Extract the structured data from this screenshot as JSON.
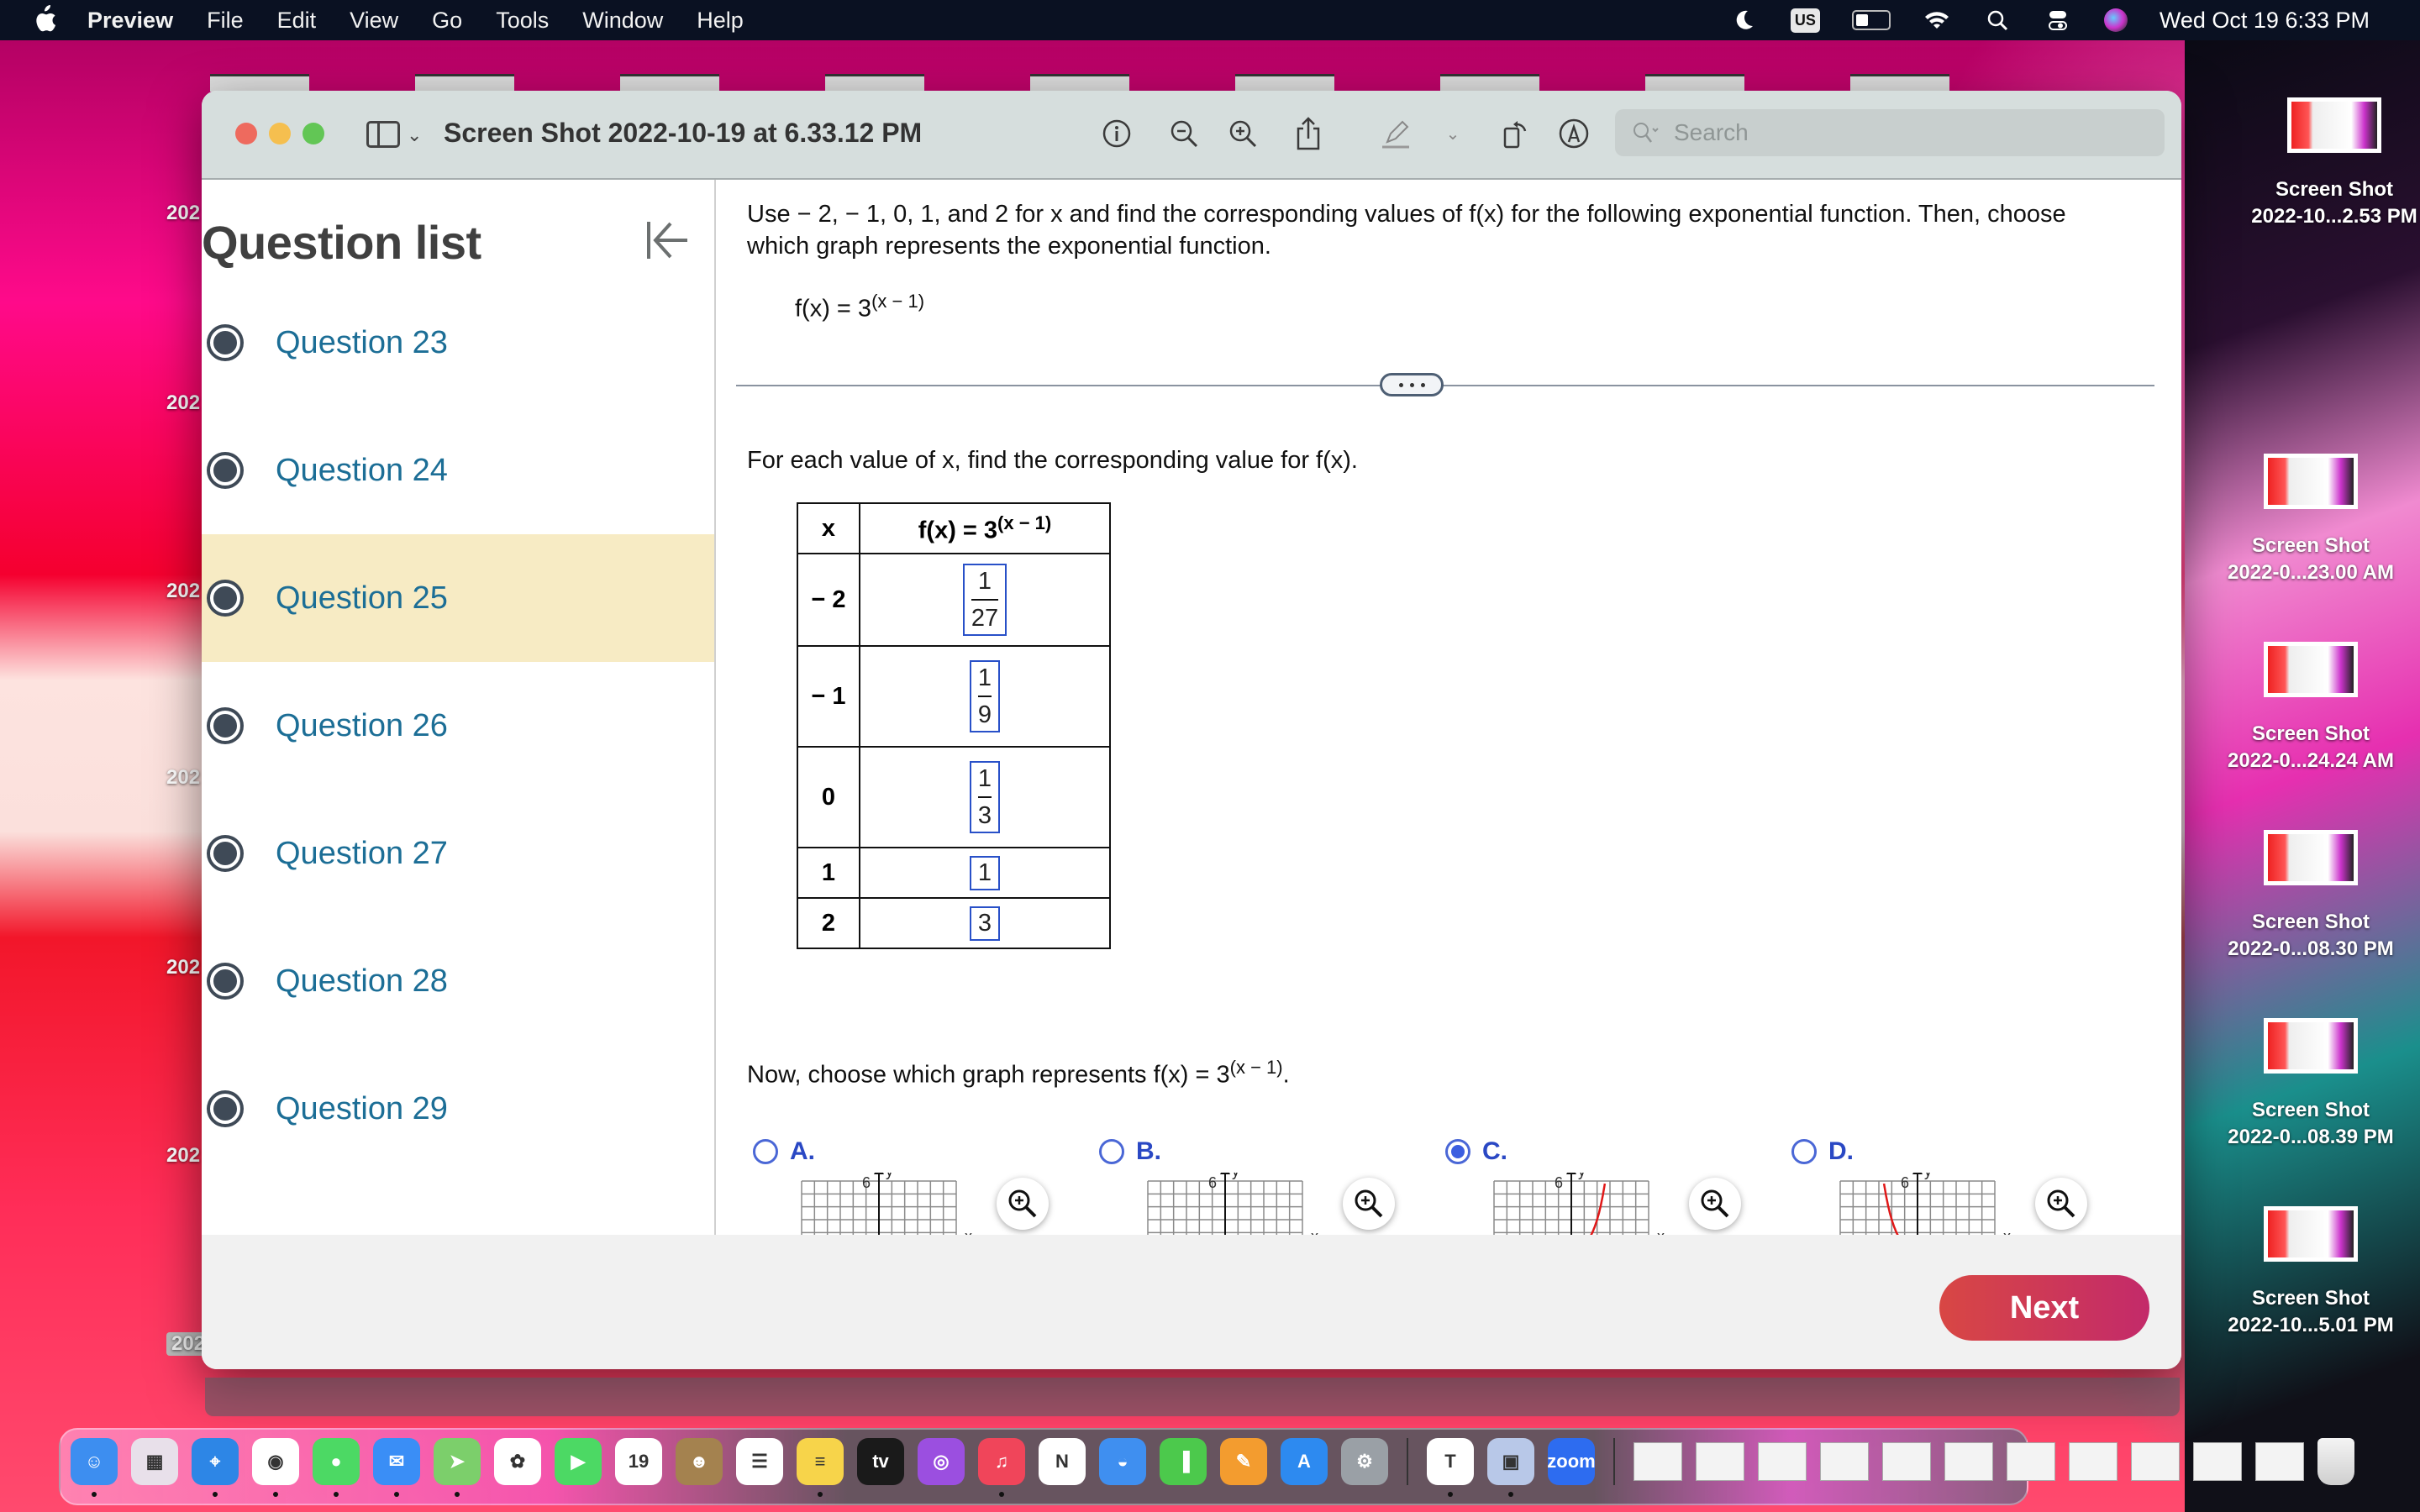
{
  "menubar": {
    "apple": "",
    "app_name": "Preview",
    "items": [
      "File",
      "Edit",
      "View",
      "Go",
      "Tools",
      "Window",
      "Help"
    ],
    "input_source": "US",
    "clock": "Wed Oct 19  6:33 PM"
  },
  "window": {
    "title": "Screen Shot 2022-10-19 at 6.33.12 PM",
    "search_placeholder": "Search",
    "search_value": ""
  },
  "question_list": {
    "title": "Question list",
    "items": [
      {
        "label": "Question 23",
        "current": false
      },
      {
        "label": "Question 24",
        "current": false
      },
      {
        "label": "Question 25",
        "current": true
      },
      {
        "label": "Question 26",
        "current": false
      },
      {
        "label": "Question 27",
        "current": false
      },
      {
        "label": "Question 28",
        "current": false
      },
      {
        "label": "Question 29",
        "current": false
      }
    ]
  },
  "question": {
    "instructions": "Use  − 2, − 1, 0, 1, and 2 for x and find the corresponding values of f(x) for the following exponential function.  Then, choose which graph represents the exponential function.",
    "function_base": "f(x) = 3",
    "function_exponent": "(x − 1)",
    "subprompt": "For each value of x, find the corresponding value for f(x).",
    "table": {
      "header_x": "x",
      "header_f_base": "f(x) = 3",
      "header_f_exp": "(x − 1)",
      "rows": [
        {
          "x": "− 2",
          "numerator": "1",
          "denominator": "27"
        },
        {
          "x": "− 1",
          "numerator": "1",
          "denominator": "9"
        },
        {
          "x": "0",
          "numerator": "1",
          "denominator": "3"
        },
        {
          "x": "1",
          "value": "1"
        },
        {
          "x": "2",
          "value": "3"
        }
      ]
    },
    "choose_prompt_pre": "Now, choose which graph represents f(x) = 3",
    "choose_prompt_exp": "(x − 1)",
    "choose_prompt_post": ".",
    "options": [
      {
        "label": "A.",
        "selected": false,
        "curve": "increasing-shifted-right",
        "y_tick": "6",
        "x_axis": "x",
        "y_axis": "y"
      },
      {
        "label": "B.",
        "selected": false,
        "curve": "decreasing-shifted-left",
        "y_tick": "6",
        "x_axis": "x",
        "y_axis": "y"
      },
      {
        "label": "C.",
        "selected": true,
        "curve": "increasing",
        "y_tick": "6",
        "x_axis": "x",
        "y_axis": "y"
      },
      {
        "label": "D.",
        "selected": false,
        "curve": "decreasing",
        "y_tick": "6",
        "x_axis": "x",
        "y_axis": "y"
      }
    ],
    "next_label": "Next"
  },
  "desktop_files": [
    {
      "line1": "Screen Shot",
      "line2": "2022-10...2.53 PM"
    },
    {
      "line1": "Screen Shot",
      "line2": "2022-0...23.00 AM"
    },
    {
      "line1": "Screen Shot",
      "line2": "2022-0...24.24 AM"
    },
    {
      "line1": "Screen Shot",
      "line2": "2022-0...08.30 PM"
    },
    {
      "line1": "Screen Shot",
      "line2": "2022-0...08.39 PM"
    },
    {
      "line1": "Screen Shot",
      "line2": "2022-10...5.01 PM"
    }
  ],
  "left_desktop_labels": [
    "202",
    "202",
    "202",
    "202",
    "202",
    "202",
    "202"
  ],
  "dock": {
    "apps": [
      {
        "name": "Finder",
        "color": "#3d8ef0",
        "glyph": "☺",
        "running": true
      },
      {
        "name": "Launchpad",
        "color": "#e8e0ea",
        "glyph": "▦",
        "running": false
      },
      {
        "name": "Safari",
        "color": "#2d86e6",
        "glyph": "⌖",
        "running": true
      },
      {
        "name": "Chrome",
        "color": "#ffffff",
        "glyph": "◉",
        "running": true
      },
      {
        "name": "Messages",
        "color": "#4cd964",
        "glyph": "●",
        "running": true
      },
      {
        "name": "Mail",
        "color": "#3a8ef6",
        "glyph": "✉",
        "running": true
      },
      {
        "name": "Maps",
        "color": "#7ccf6b",
        "glyph": "➤",
        "running": true
      },
      {
        "name": "Photos",
        "color": "#ffffff",
        "glyph": "✿",
        "running": false
      },
      {
        "name": "FaceTime",
        "color": "#4cd964",
        "glyph": "▶",
        "running": false
      },
      {
        "name": "Calendar",
        "color": "#ffffff",
        "glyph": "19",
        "running": false
      },
      {
        "name": "Contacts",
        "color": "#a4824f",
        "glyph": "☻",
        "running": false
      },
      {
        "name": "Reminders",
        "color": "#ffffff",
        "glyph": "☰",
        "running": false
      },
      {
        "name": "Notes",
        "color": "#f7d44a",
        "glyph": "≡",
        "running": true
      },
      {
        "name": "TV",
        "color": "#1a1a1a",
        "glyph": "tv",
        "running": false
      },
      {
        "name": "Podcasts",
        "color": "#9b4fe0",
        "glyph": "◎",
        "running": false
      },
      {
        "name": "Music",
        "color": "#f0455a",
        "glyph": "♫",
        "running": true
      },
      {
        "name": "News",
        "color": "#ffffff",
        "glyph": "N",
        "running": false
      },
      {
        "name": "Keynote",
        "color": "#3f8ff0",
        "glyph": "◒",
        "running": false
      },
      {
        "name": "Numbers",
        "color": "#4cc94c",
        "glyph": "▐",
        "running": false
      },
      {
        "name": "Pages",
        "color": "#f39c2f",
        "glyph": "✎",
        "running": false
      },
      {
        "name": "App Store",
        "color": "#2d8af0",
        "glyph": "A",
        "running": false
      },
      {
        "name": "System Preferences",
        "color": "#9aa0a6",
        "glyph": "⚙",
        "running": false
      }
    ],
    "recents": [
      {
        "name": "Microsoft Teams",
        "color": "#ffffff",
        "glyph": "T",
        "running": true
      },
      {
        "name": "Preview",
        "color": "#b8c8e8",
        "glyph": "▣",
        "running": true
      },
      {
        "name": "zoom.us",
        "color": "#2d6cf0",
        "glyph": "zoom",
        "running": false
      }
    ],
    "documents": [
      "Document",
      "Safari window",
      "Chrome window",
      "Preview window",
      "Preview window",
      "Preview window",
      "Preview window",
      "Finder window",
      "Safari window",
      "Safari window",
      "Chrome window"
    ],
    "trash": "Trash"
  }
}
